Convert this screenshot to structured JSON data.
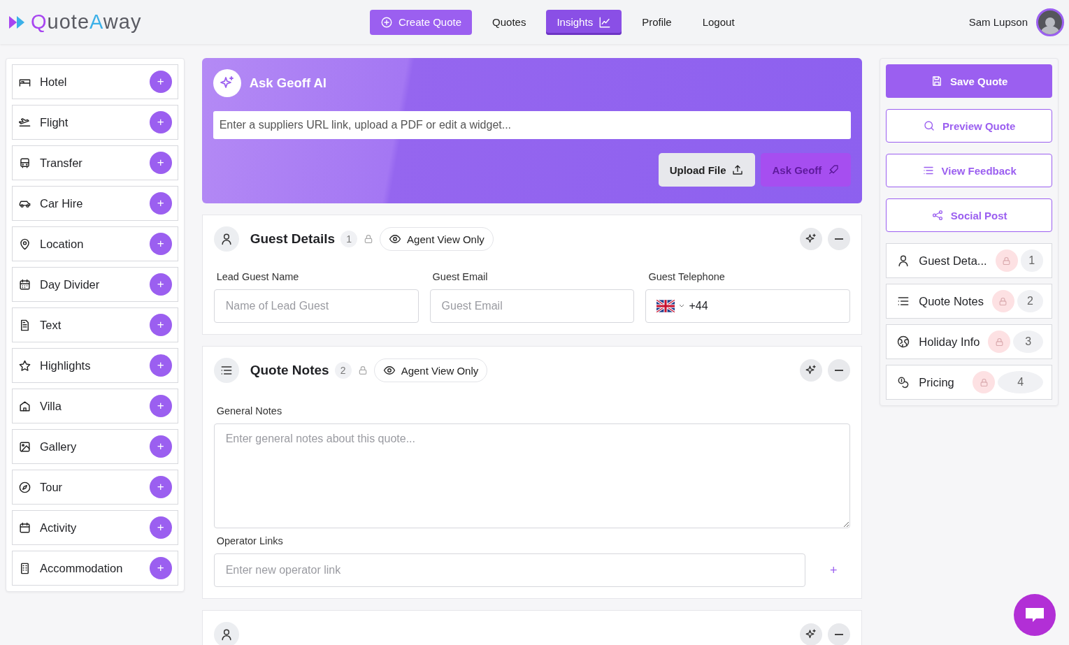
{
  "header": {
    "logo": [
      "Q",
      "uote",
      "A",
      "way"
    ],
    "nav": [
      {
        "label": "Create Quote",
        "kind": "action",
        "selected": false
      },
      {
        "label": "Quotes",
        "kind": "link",
        "selected": false
      },
      {
        "label": "Insights",
        "kind": "link",
        "selected": true
      },
      {
        "label": "Profile",
        "kind": "link",
        "selected": false
      },
      {
        "label": "Logout",
        "kind": "link",
        "selected": false
      }
    ],
    "user": {
      "name": "Sam Lupson"
    }
  },
  "widgets": [
    {
      "label": "Hotel",
      "add": "+"
    },
    {
      "label": "Flight",
      "add": "+"
    },
    {
      "label": "Transfer",
      "add": "+"
    },
    {
      "label": "Car Hire",
      "add": "+"
    },
    {
      "label": "Location",
      "add": "+"
    },
    {
      "label": "Day Divider",
      "add": "+"
    },
    {
      "label": "Text",
      "add": "+"
    },
    {
      "label": "Highlights",
      "add": "+"
    },
    {
      "label": "Villa",
      "add": "+"
    },
    {
      "label": "Gallery",
      "add": "+"
    },
    {
      "label": "Tour",
      "add": "+"
    },
    {
      "label": "Activity",
      "add": "+"
    },
    {
      "label": "Accommodation",
      "add": "+"
    }
  ],
  "ai": {
    "title": "Ask Geoff AI",
    "placeholder": "Enter a suppliers URL link, upload a PDF or edit a widget...",
    "upload": "Upload File",
    "ask": {
      "label": "Ask Geoff",
      "disabled": true
    }
  },
  "sections": [
    {
      "kind": "guest",
      "title": "Guest Details",
      "count": "1",
      "chip": "Agent View Only",
      "fields": [
        {
          "label": "Lead Guest Name",
          "placeholder": "Name of Lead Guest"
        },
        {
          "label": "Guest Email",
          "placeholder": "Guest Email"
        },
        {
          "label": "Guest Telephone",
          "value": "+44"
        }
      ]
    },
    {
      "kind": "notes",
      "title": "Quote Notes",
      "count": "2",
      "chip": "Agent View Only",
      "notes_label": "General Notes",
      "notes_placeholder": "Enter general notes about this quote...",
      "links_label": "Operator Links",
      "links_placeholder": "Enter new operator link",
      "add": "+"
    },
    {
      "kind": "collapsed"
    }
  ],
  "actions": [
    {
      "label": "Save Quote",
      "kind": "primary"
    },
    {
      "label": "Preview Quote",
      "kind": "outline"
    },
    {
      "label": "View Feedback",
      "kind": "outline"
    },
    {
      "label": "Social Post",
      "kind": "outline"
    }
  ],
  "outline": [
    {
      "label": "Guest Deta...",
      "number": "1"
    },
    {
      "label": "Quote Notes",
      "number": "2"
    },
    {
      "label": "Holiday Info",
      "number": "3"
    },
    {
      "label": "Pricing",
      "number": "4"
    }
  ]
}
